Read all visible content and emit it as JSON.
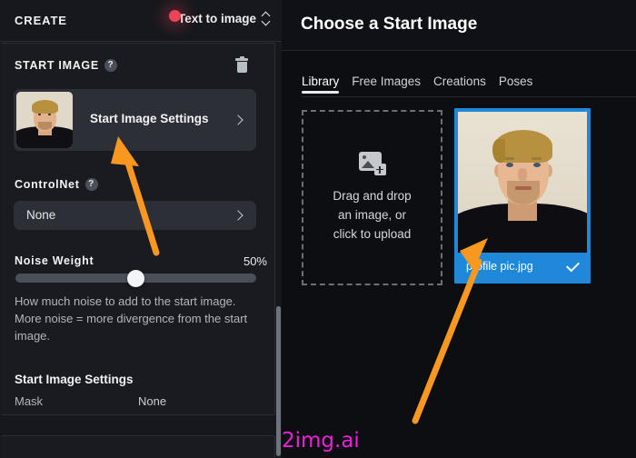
{
  "sidebar": {
    "header": {
      "create_label": "CREATE",
      "mode_value": "Text to image",
      "spinner_icon": "chevron-up-down-icon"
    },
    "start_image": {
      "section_title": "START IMAGE",
      "help_badge": "?",
      "delete_icon": "trash-icon",
      "card_label": "Start Image Settings",
      "card_chevron": "chevron-right-icon",
      "thumbnail_alt": "portrait thumbnail"
    },
    "controlnet": {
      "section_title": "ControlNet",
      "help_badge": "?",
      "selected_value": "None",
      "chevron": "chevron-right-icon"
    },
    "noise_weight": {
      "label": "Noise Weight",
      "value": "50%",
      "slider_percent": 50,
      "description": "How much noise to add to the start image. More noise = more divergence from the start image."
    },
    "start_image_settings": {
      "heading": "Start Image Settings",
      "rows": [
        {
          "label": "Mask",
          "value": "None"
        }
      ]
    }
  },
  "panel": {
    "title": "Choose a Start Image",
    "tabs": [
      {
        "label": "Library",
        "active": true
      },
      {
        "label": "Free Images",
        "active": false
      },
      {
        "label": "Creations",
        "active": false
      },
      {
        "label": "Poses",
        "active": false
      }
    ],
    "upload": {
      "icon": "image-add-icon",
      "line1": "Drag and drop",
      "line2": "an image, or",
      "line3": "click to upload"
    },
    "images": [
      {
        "name": "profile pic.jpg",
        "selected": true,
        "check_icon": "check-icon",
        "accent_color": "#1f88d8"
      }
    ]
  },
  "overlay": {
    "cursor_icon": "cursor-dot",
    "cursor_color": "#ee4257",
    "arrow_color": "#f89820",
    "annotations": [
      {
        "name": "arrow-to-start-image-settings"
      },
      {
        "name": "arrow-to-selected-image"
      }
    ],
    "watermark": "2img.ai",
    "watermark_color": "#f020d8"
  }
}
